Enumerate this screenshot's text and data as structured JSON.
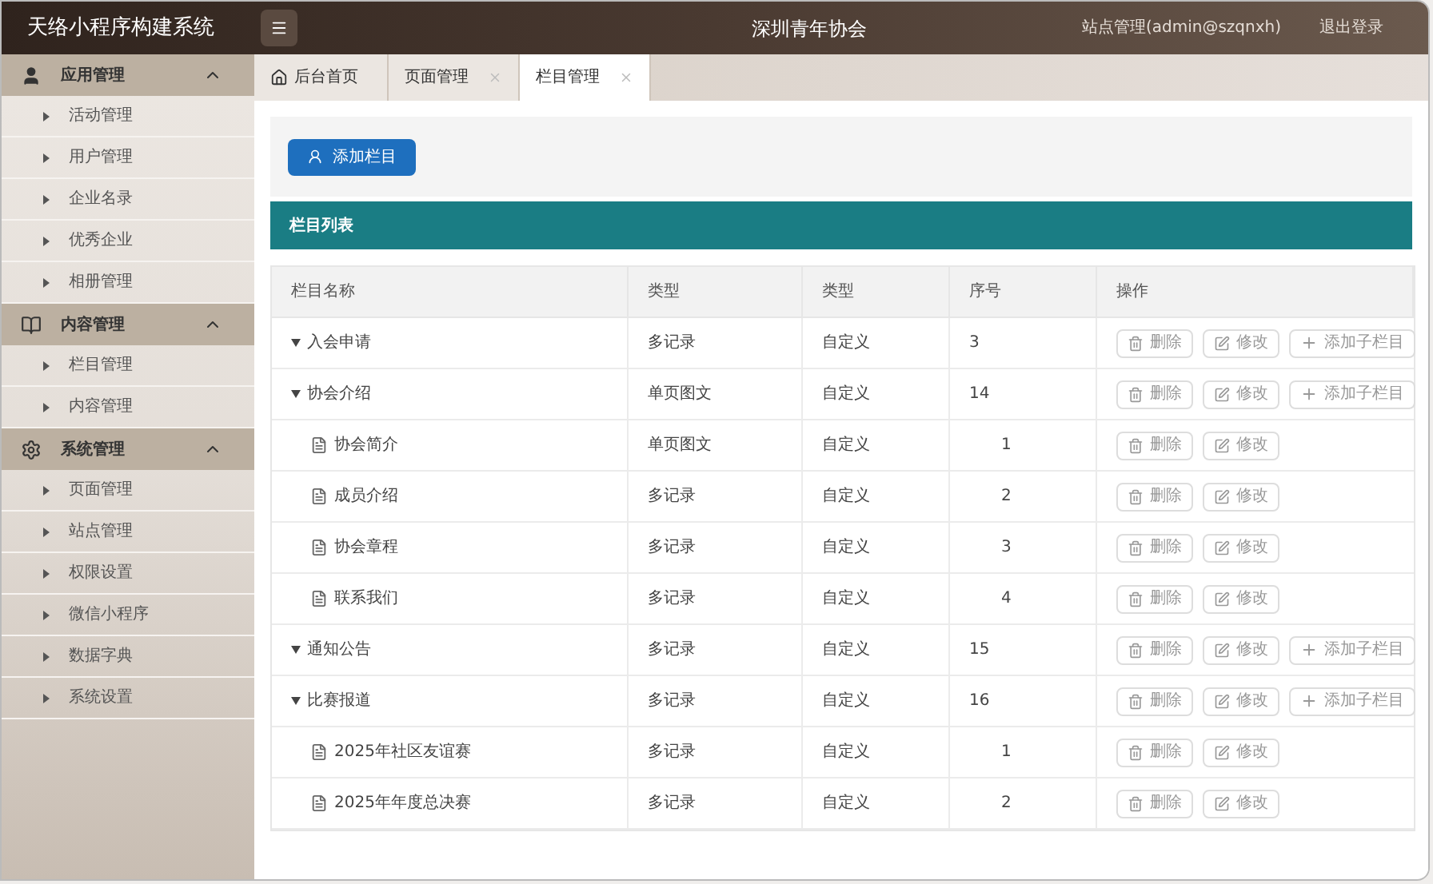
{
  "header": {
    "app_title": "天络小程序构建系统",
    "org_title": "深圳青年协会",
    "user": "站点管理(admin@szqnxh)",
    "logout": "退出登录"
  },
  "sidebar": {
    "groups": [
      {
        "title": "应用管理",
        "kind": "user",
        "expanded": true,
        "items": [
          "活动管理",
          "用户管理",
          "企业名录",
          "优秀企业",
          "相册管理"
        ]
      },
      {
        "title": "内容管理",
        "kind": "book",
        "expanded": true,
        "items": [
          "栏目管理",
          "内容管理"
        ]
      },
      {
        "title": "系统管理",
        "kind": "gear",
        "expanded": true,
        "items": [
          "页面管理",
          "站点管理",
          "权限设置",
          "微信小程序",
          "数据字典",
          "系统设置"
        ]
      }
    ]
  },
  "tabs": [
    {
      "label": "后台首页",
      "kind": "home",
      "selected": false
    },
    {
      "label": "页面管理",
      "kind": "page",
      "selected": false
    },
    {
      "label": "栏目管理",
      "kind": "page",
      "selected": true
    }
  ],
  "add_button": "添加栏目",
  "panel_title": "栏目列表",
  "table": {
    "columns": [
      "栏目名称",
      "类型",
      "类型",
      "序号",
      "操作"
    ],
    "rows": [
      {
        "name": "入会申请",
        "type": "多记录",
        "source": "自定义",
        "order": "3",
        "expanded": true,
        "actions": [
          {
            "kind": "delete",
            "label": "删除"
          },
          {
            "kind": "edit",
            "label": "修改"
          },
          {
            "kind": "add",
            "label": "添加子栏目"
          }
        ],
        "children": []
      },
      {
        "name": "协会介绍",
        "type": "单页图文",
        "source": "自定义",
        "order": "14",
        "expanded": true,
        "actions": [
          {
            "kind": "delete",
            "label": "删除"
          },
          {
            "kind": "edit",
            "label": "修改"
          },
          {
            "kind": "add",
            "label": "添加子栏目"
          }
        ],
        "children": [
          {
            "name": "协会简介",
            "type": "单页图文",
            "source": "自定义",
            "order": "1",
            "actions": [
              {
                "kind": "delete",
                "label": "删除"
              },
              {
                "kind": "edit",
                "label": "修改"
              }
            ]
          },
          {
            "name": "成员介绍",
            "type": "多记录",
            "source": "自定义",
            "order": "2",
            "actions": [
              {
                "kind": "delete",
                "label": "删除"
              },
              {
                "kind": "edit",
                "label": "修改"
              }
            ]
          },
          {
            "name": "协会章程",
            "type": "多记录",
            "source": "自定义",
            "order": "3",
            "actions": [
              {
                "kind": "delete",
                "label": "删除"
              },
              {
                "kind": "edit",
                "label": "修改"
              }
            ]
          },
          {
            "name": "联系我们",
            "type": "多记录",
            "source": "自定义",
            "order": "4",
            "actions": [
              {
                "kind": "delete",
                "label": "删除"
              },
              {
                "kind": "edit",
                "label": "修改"
              }
            ]
          }
        ]
      },
      {
        "name": "通知公告",
        "type": "多记录",
        "source": "自定义",
        "order": "15",
        "expanded": true,
        "actions": [
          {
            "kind": "delete",
            "label": "删除"
          },
          {
            "kind": "edit",
            "label": "修改"
          },
          {
            "kind": "add",
            "label": "添加子栏目"
          }
        ],
        "children": []
      },
      {
        "name": "比赛报道",
        "type": "多记录",
        "source": "自定义",
        "order": "16",
        "expanded": true,
        "actions": [
          {
            "kind": "delete",
            "label": "删除"
          },
          {
            "kind": "edit",
            "label": "修改"
          },
          {
            "kind": "add",
            "label": "添加子栏目"
          }
        ],
        "children": [
          {
            "name": "2025年社区友谊赛",
            "type": "多记录",
            "source": "自定义",
            "order": "1",
            "actions": [
              {
                "kind": "delete",
                "label": "删除"
              },
              {
                "kind": "edit",
                "label": "修改"
              }
            ]
          },
          {
            "name": "2025年年度总决赛",
            "type": "多记录",
            "source": "自定义",
            "order": "2",
            "actions": [
              {
                "kind": "delete",
                "label": "删除"
              },
              {
                "kind": "edit",
                "label": "修改"
              }
            ]
          }
        ]
      }
    ]
  }
}
